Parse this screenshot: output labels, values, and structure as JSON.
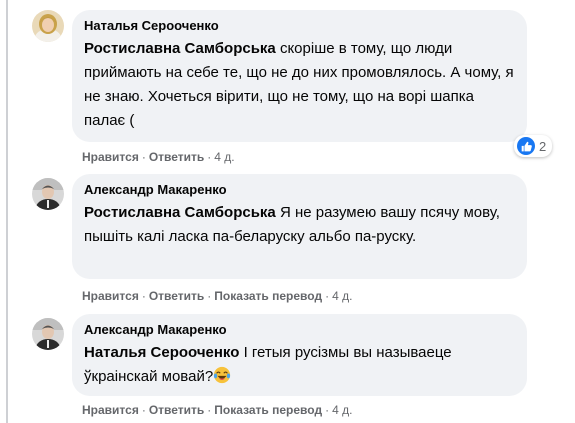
{
  "comments": [
    {
      "author": "Наталья Серооченко",
      "mention": "Ростиславна Самборська",
      "text": " скоріше в тому, що люди приймають на себе те, що не до них промовлялось. А чому, я не знаю. Хочеться вірити, що не тому, що на ворі шапка палає (",
      "like_label": "Нравится",
      "reply_label": "Ответить",
      "time": "4 д.",
      "reaction_count": "2"
    },
    {
      "author": "Александр Макаренко",
      "mention": "Ростиславна Самборська",
      "text": " Я не разумею вашу псячу мову, пышіть калі ласка па-беларуску альбо па-руску.",
      "like_label": "Нравится",
      "reply_label": "Ответить",
      "translate_label": "Показать перевод",
      "time": "4 д."
    },
    {
      "author": "Александр Макаренко",
      "mention": "Наталья Серооченко",
      "text": " І гетыя русізмы вы называеце ўкраінскай мовай?",
      "emoji": "laughing-crying-emoji",
      "like_label": "Нравится",
      "reply_label": "Ответить",
      "translate_label": "Показать перевод",
      "time": "4 д."
    }
  ],
  "colors": {
    "bubble": "#f0f2f5",
    "meta": "#65676b",
    "like_blue": "#1877f2",
    "thread_line": "#ced0d4"
  }
}
